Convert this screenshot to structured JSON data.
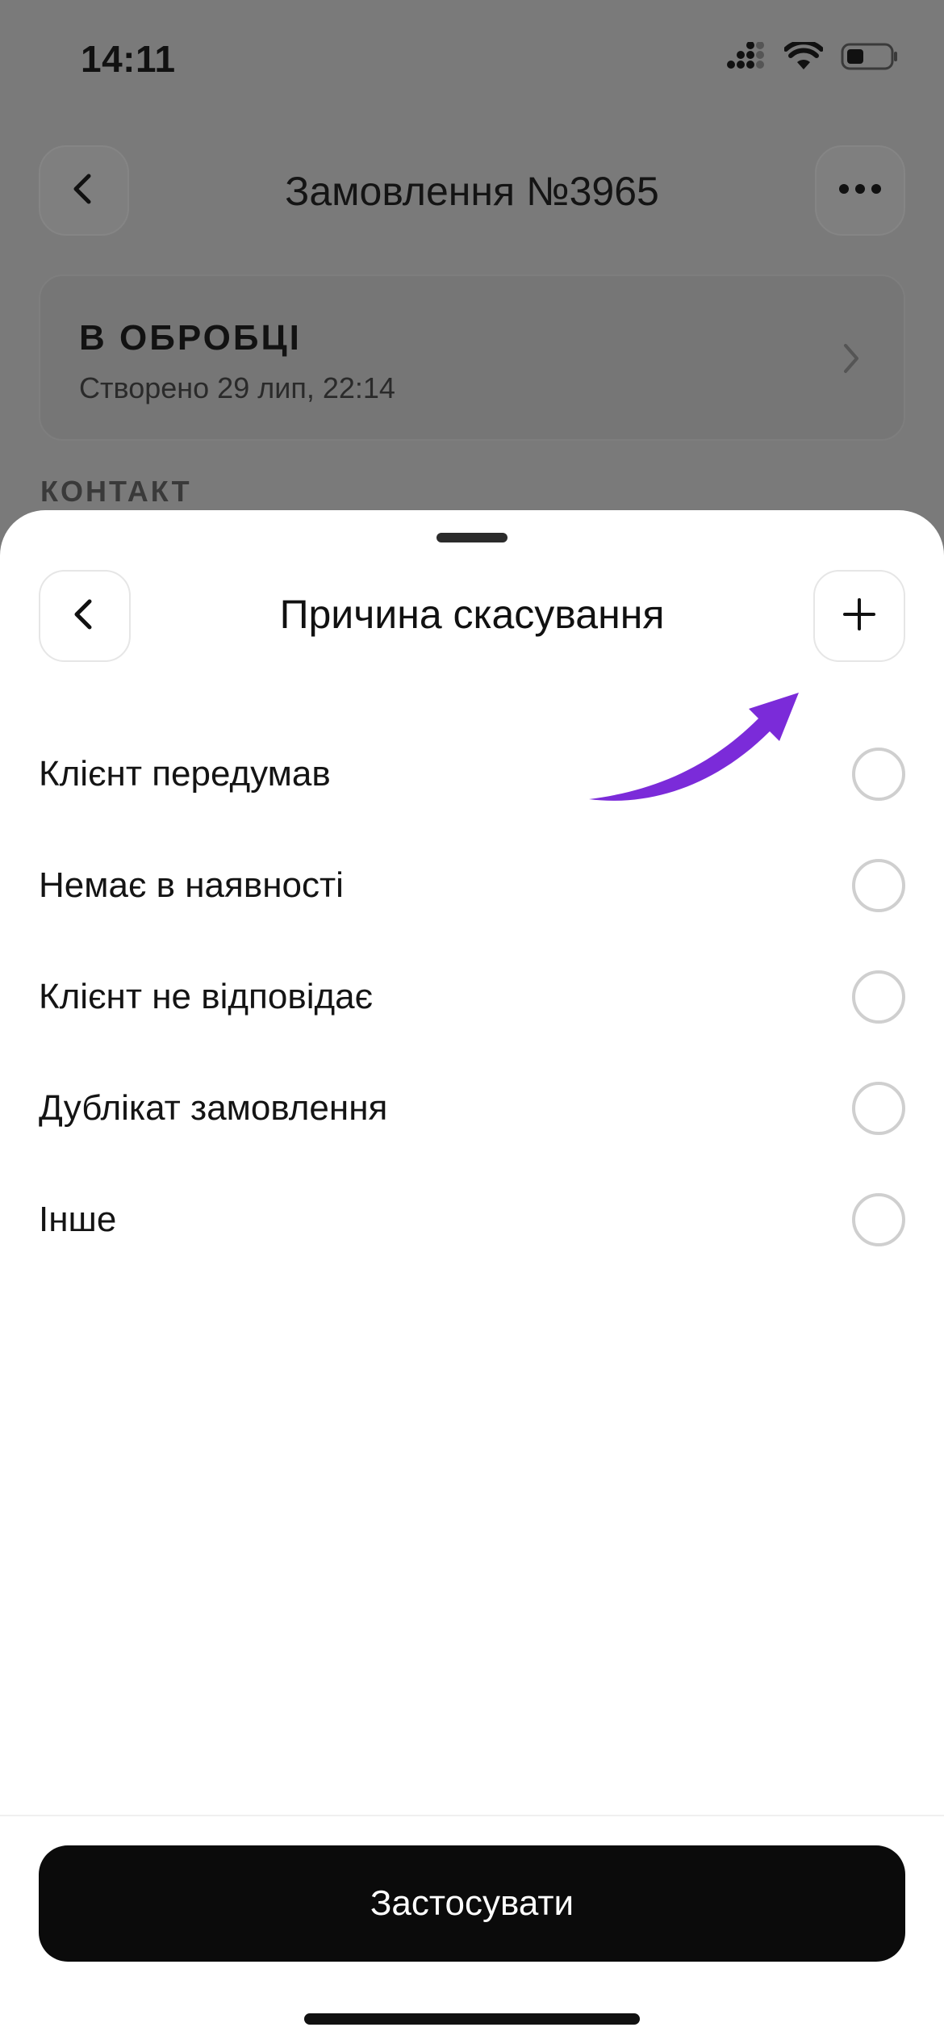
{
  "status_bar": {
    "time": "14:11",
    "icons": [
      "cellular-signal-icon",
      "wifi-icon",
      "battery-icon"
    ]
  },
  "background_page": {
    "title": "Замовлення №3965",
    "back_icon": "chevron-left-icon",
    "more_icon": "more-horizontal-icon",
    "status_card": {
      "status": "В ОБРОБЦІ",
      "created": "Створено 29 лип, 22:14",
      "chevron_icon": "chevron-right-icon"
    },
    "section_label": "КОНТАКТ"
  },
  "sheet": {
    "title": "Причина скасування",
    "back_icon": "chevron-left-icon",
    "add_icon": "plus-icon",
    "annotation": {
      "icon": "arrow-annotation-icon",
      "color": "#7b2bd9"
    },
    "options": [
      {
        "label": "Клієнт передумав",
        "selected": false
      },
      {
        "label": "Немає в наявності",
        "selected": false
      },
      {
        "label": "Клієнт не відповідає",
        "selected": false
      },
      {
        "label": "Дублікат замовлення",
        "selected": false
      },
      {
        "label": "Інше",
        "selected": false
      }
    ],
    "apply_label": "Застосувати"
  },
  "colors": {
    "overlay": "#7a7a7a",
    "sheet_bg": "#ffffff",
    "primary_button": "#0b0b0b",
    "accent_arrow": "#7b2bd9"
  }
}
